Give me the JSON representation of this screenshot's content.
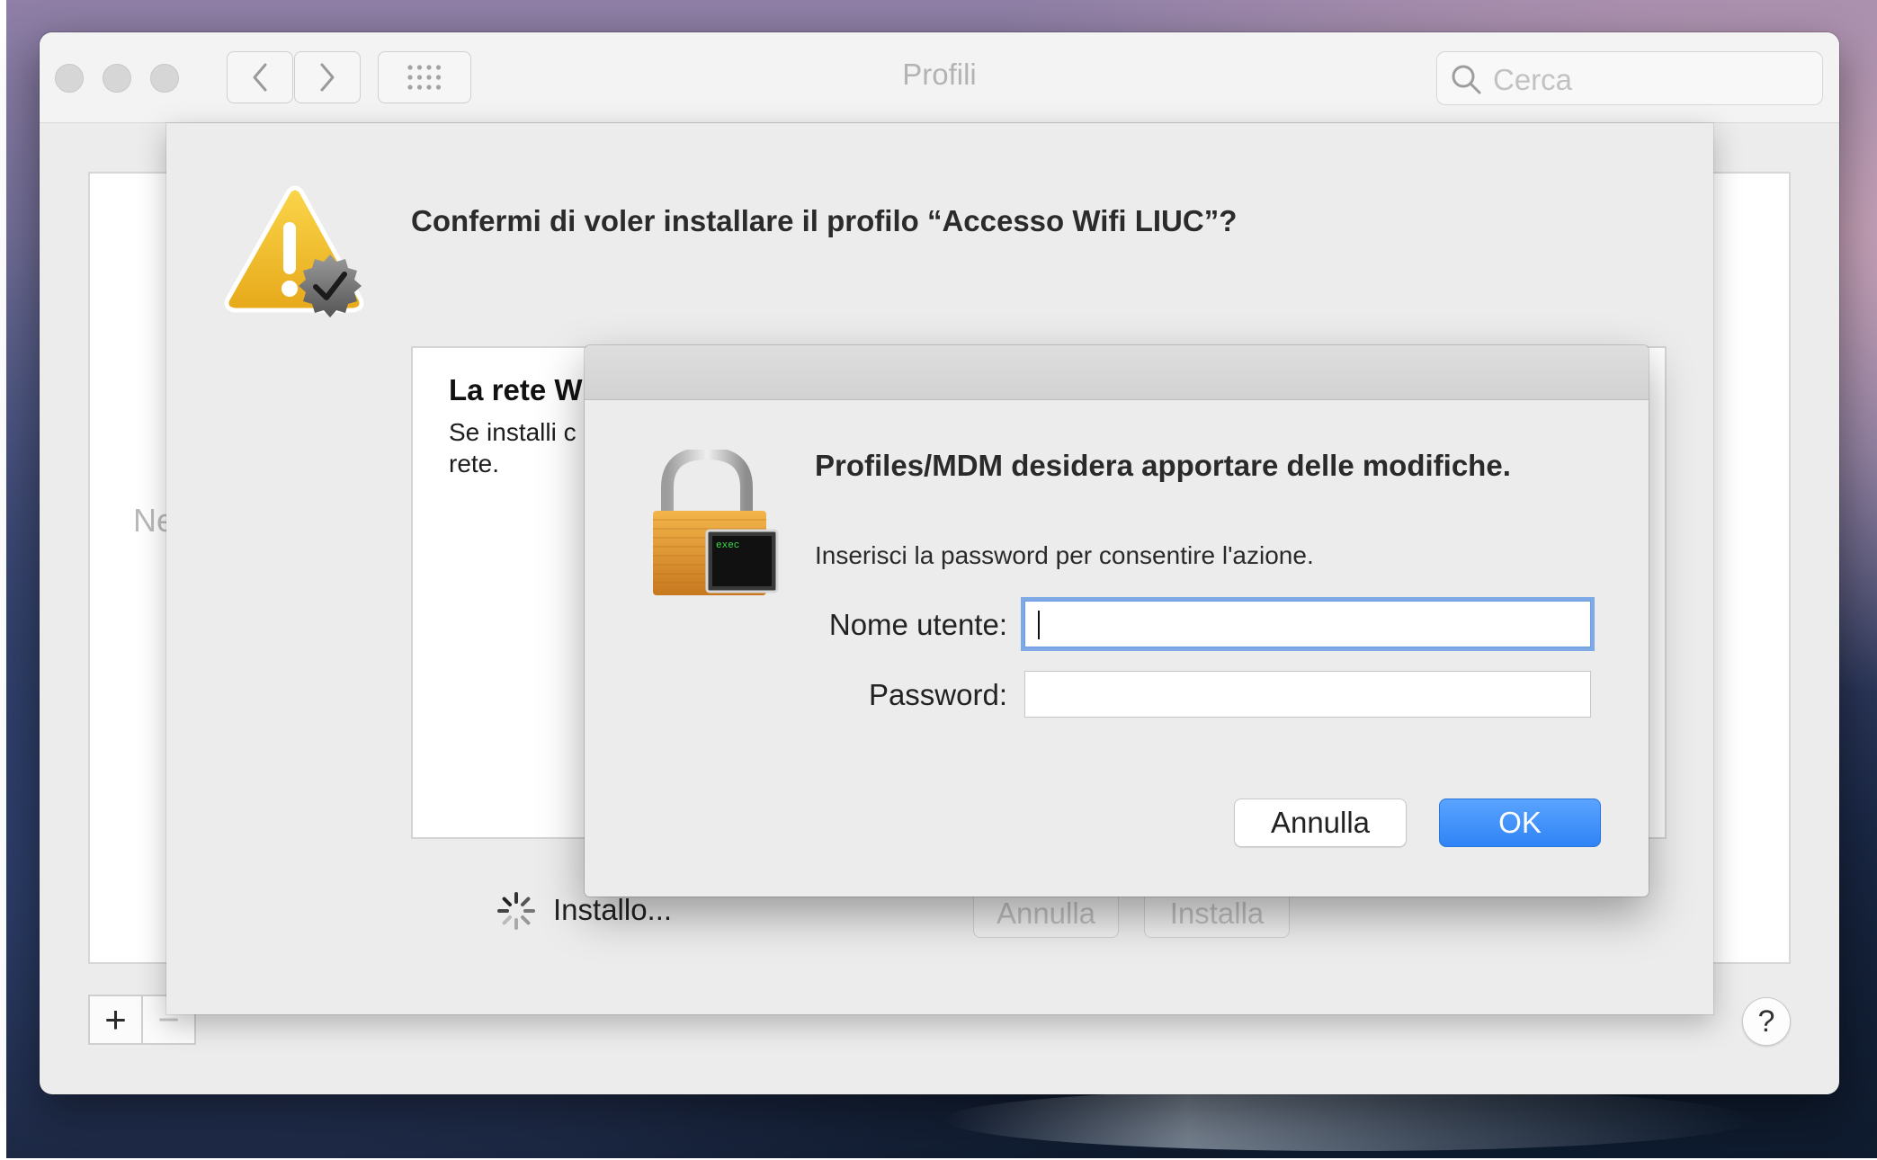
{
  "window": {
    "title": "Profili",
    "search_placeholder": "Cerca",
    "background_partial_label": "Ne"
  },
  "toolbar": {
    "back_icon": "chevron-left-icon",
    "forward_icon": "chevron-right-icon",
    "grid_icon": "show-all-grid-icon"
  },
  "sheet": {
    "question": "Confermi di voler installare il profilo “Accesso Wifi LIUC”?",
    "profile_heading": "La rete W",
    "profile_desc_line1": "Se installi c",
    "profile_desc_line2": "rete.",
    "installing_label": "Installo...",
    "cancel_label": "Annulla",
    "install_label": "Installa"
  },
  "auth_dialog": {
    "title": "Profiles/MDM desidera apportare delle modifiche.",
    "message": "Inserisci la password per consentire l'azione.",
    "username_label": "Nome utente:",
    "username_value": "",
    "password_label": "Password:",
    "password_value": "",
    "cancel_label": "Annulla",
    "ok_label": "OK",
    "lock_badge_text": "exec"
  },
  "footer": {
    "add_label": "+",
    "remove_label": "−",
    "help_label": "?"
  },
  "colors": {
    "accent": "#2f83f5",
    "focus_ring": "#7fa9e6",
    "warning_yellow": "#f2c12e"
  }
}
